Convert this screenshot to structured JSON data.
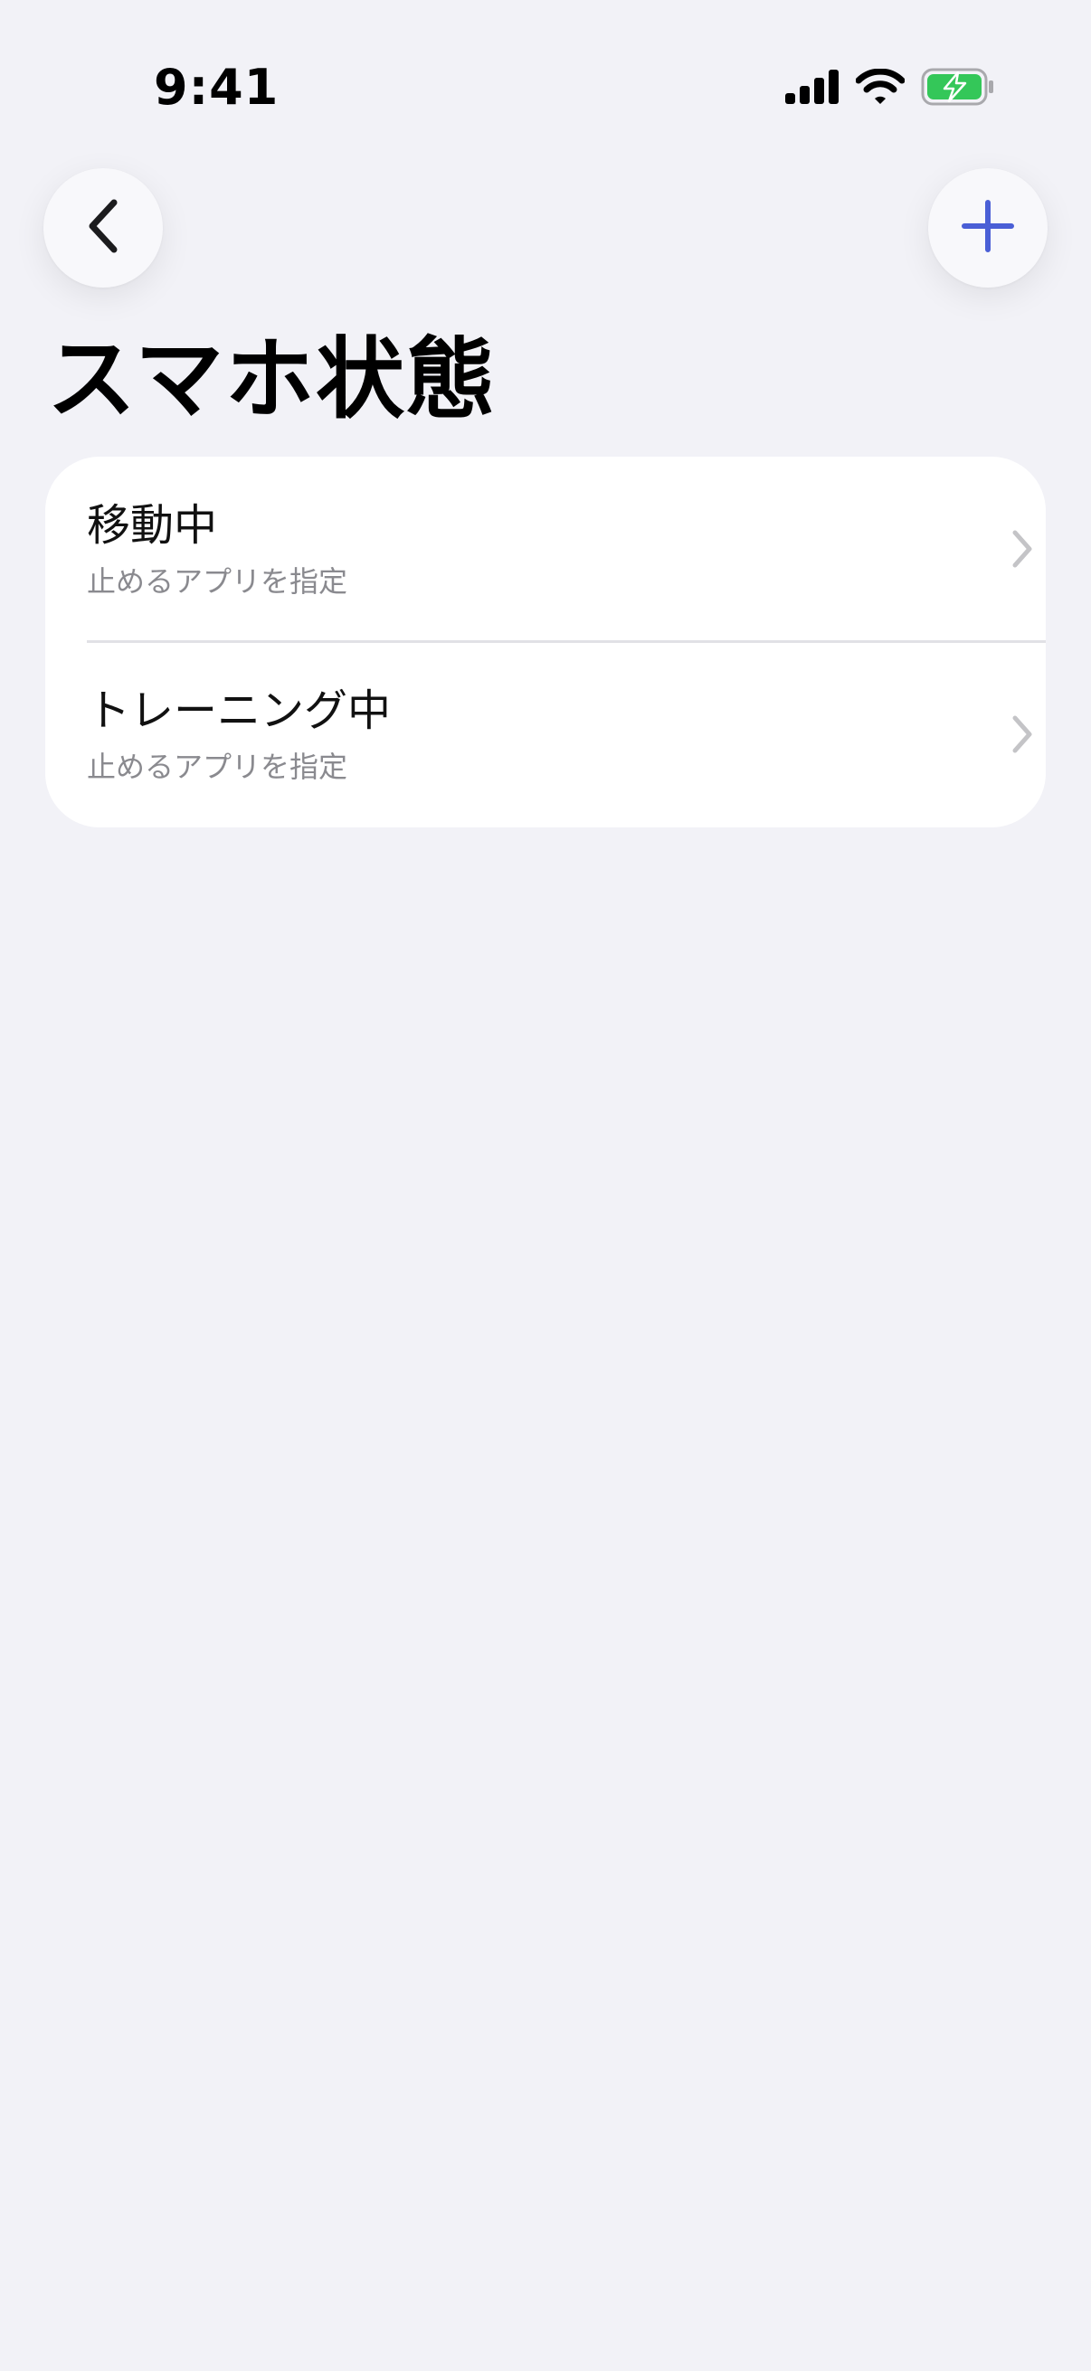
{
  "status_bar": {
    "time": "9:41",
    "icons": [
      "cellular-signal-icon",
      "wifi-icon",
      "battery-charging-icon"
    ],
    "battery_color": "#34c759"
  },
  "nav": {
    "back_icon": "chevron-left-icon",
    "add_icon": "plus-icon",
    "accent_color": "#4a5fd6"
  },
  "page": {
    "title": "スマホ状態"
  },
  "list": {
    "items": [
      {
        "title": "移動中",
        "subtitle": "止めるアプリを指定"
      },
      {
        "title": "トレーニング中",
        "subtitle": "止めるアプリを指定"
      }
    ]
  }
}
